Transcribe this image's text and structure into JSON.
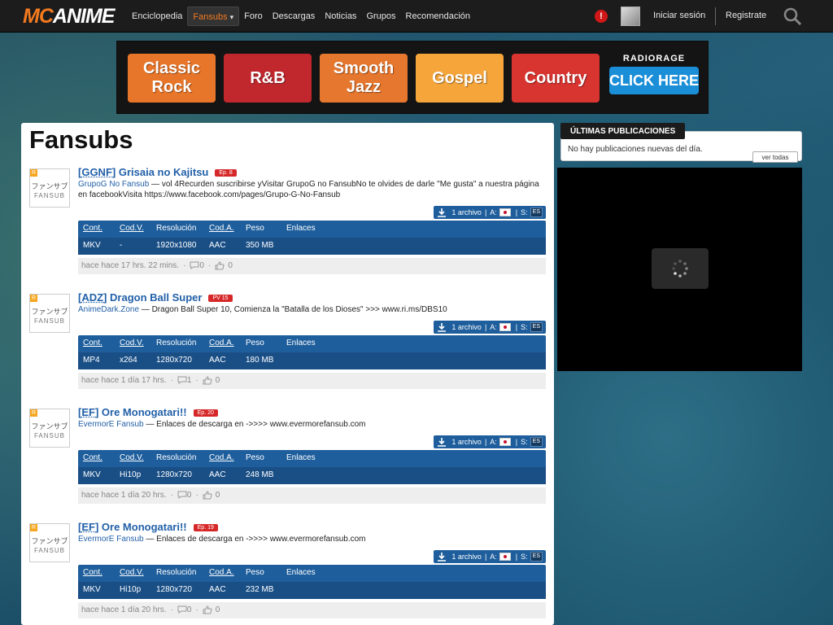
{
  "logo": {
    "mc": "MC",
    "anime": "ANIME"
  },
  "nav": [
    {
      "label": "Enciclopedia"
    },
    {
      "label": "Fansubs",
      "active": true
    },
    {
      "label": "Foro"
    },
    {
      "label": "Descargas"
    },
    {
      "label": "Noticias"
    },
    {
      "label": "Grupos"
    },
    {
      "label": "Recomendación"
    }
  ],
  "header": {
    "alert": "!",
    "login": "Iniciar sesión",
    "register": "Registrate"
  },
  "banner": {
    "buttons": [
      "Classic Rock",
      "R&B",
      "Smooth Jazz",
      "Gospel",
      "Country"
    ],
    "brand": "RADIORAGE",
    "cta": "CLICK HERE"
  },
  "page": {
    "title": "Fansubs"
  },
  "table_headers": {
    "cont": "Cont.",
    "codv": "Cod.V.",
    "res": "Resolución",
    "coda": "Cod.A.",
    "peso": "Peso",
    "enlaces": "Enlaces"
  },
  "file_labels": {
    "a": "A:",
    "s": "S:",
    "es": "ES"
  },
  "thumb": {
    "jp": "ファンサブ",
    "en": "FANSUB",
    "tag": "R"
  },
  "entries": [
    {
      "group_tag": "[GGNF]",
      "title": "Grisaia no Kajitsu",
      "badge": "Ep. 8",
      "group": "GrupoG No Fansub",
      "desc": " — vol 4Recurden suscribirse yVisitar GrupoG no FansubNo te olvides de darle \"Me gusta\" a nuestra página en facebookVisita https://www.facebook.com/pages/Grupo-G-No-Fansub",
      "files": "1 archivo",
      "row": {
        "cont": "MKV",
        "codv": "-",
        "res": "1920x1080",
        "coda": "AAC",
        "peso": "350 MB"
      },
      "time": "hace hace 17 hrs. 22 mins.",
      "comments": "0",
      "likes": "0"
    },
    {
      "group_tag": "[ADZ]",
      "title": "Dragon Ball Super",
      "badge": "PV 15",
      "group": "AnimeDark.Zone",
      "desc": " — Dragon Ball Super 10, Comienza la \"Batalla de los Dioses\" >>> www.ri.ms/DBS10",
      "files": "1 archivo",
      "row": {
        "cont": "MP4",
        "codv": "x264",
        "res": "1280x720",
        "coda": "AAC",
        "peso": "180 MB"
      },
      "time": "hace hace 1 día 17 hrs.",
      "comments": "1",
      "likes": "0"
    },
    {
      "group_tag": "[EF]",
      "title": "Ore Monogatari!!",
      "badge": "Ep. 20",
      "group": "EvermorE Fansub",
      "desc": " — Enlaces de descarga en ->>>> www.evermorefansub.com",
      "files": "1 archivo",
      "row": {
        "cont": "MKV",
        "codv": "Hi10p",
        "res": "1280x720",
        "coda": "AAC",
        "peso": "248 MB"
      },
      "time": "hace hace 1 día 20 hrs.",
      "comments": "0",
      "likes": "0"
    },
    {
      "group_tag": "[EF]",
      "title": "Ore Monogatari!!",
      "badge": "Ep. 19",
      "group": "EvermorE Fansub",
      "desc": " — Enlaces de descarga en ->>>> www.evermorefansub.com",
      "files": "1 archivo",
      "row": {
        "cont": "MKV",
        "codv": "Hi10p",
        "res": "1280x720",
        "coda": "AAC",
        "peso": "232 MB"
      },
      "time": "hace hace 1 día 20 hrs.",
      "comments": "0",
      "likes": "0"
    }
  ],
  "sidebar": {
    "header": "ÚLTIMAS PUBLICACIONES",
    "message": "No hay publicaciones nuevas del día.",
    "button": "ver todas"
  },
  "colors": {
    "accent": "#f47a1f",
    "link": "#2260a8",
    "table": "#1e5e9c",
    "badge": "#d62828"
  }
}
